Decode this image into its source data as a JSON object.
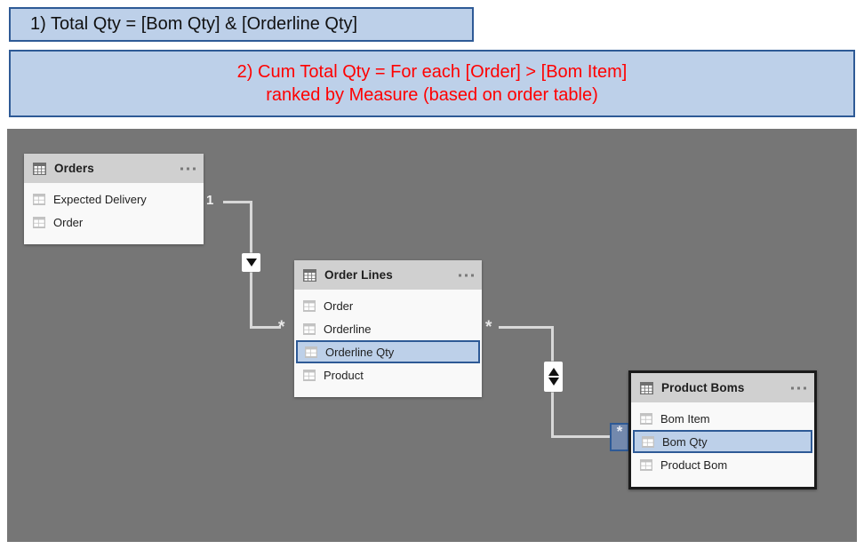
{
  "banners": {
    "one": "1) Total Qty = [Bom Qty] & [Orderline Qty]",
    "two_line1": "2) Cum Total Qty = For each [Order] > [Bom Item]",
    "two_line2": "ranked by Measure (based on order table)",
    "accent_border": "#2e5a96",
    "accent_fill": "#bdd0e9",
    "text_color_one": "#111111",
    "text_color_two": "#ff0000"
  },
  "canvas": {
    "background": "#767676"
  },
  "tables": [
    {
      "name": "Orders",
      "menu": "...",
      "selected": false,
      "fields": [
        {
          "label": "Expected Delivery",
          "highlighted": false
        },
        {
          "label": "Order",
          "highlighted": false
        }
      ]
    },
    {
      "name": "Order Lines",
      "menu": "...",
      "selected": false,
      "fields": [
        {
          "label": "Order",
          "highlighted": false
        },
        {
          "label": "Orderline",
          "highlighted": false
        },
        {
          "label": "Orderline Qty",
          "highlighted": true
        },
        {
          "label": "Product",
          "highlighted": false
        }
      ]
    },
    {
      "name": "Product Boms",
      "menu": "...",
      "selected": true,
      "fields": [
        {
          "label": "Bom Item",
          "highlighted": false
        },
        {
          "label": "Bom Qty",
          "highlighted": true
        },
        {
          "label": "Product Bom",
          "highlighted": false
        }
      ]
    }
  ],
  "relationships": [
    {
      "from_table": "Orders",
      "to_table": "Order Lines",
      "from_cardinality": "1",
      "to_cardinality": "*",
      "cross_filter": "single",
      "cross_filter_glyph": "down-triangle"
    },
    {
      "from_table": "Order Lines",
      "to_table": "Product Boms",
      "from_cardinality": "*",
      "to_cardinality": "*",
      "cross_filter": "both",
      "cross_filter_glyph": "up-down-triangles"
    }
  ],
  "line_color": "#d8d8d8"
}
